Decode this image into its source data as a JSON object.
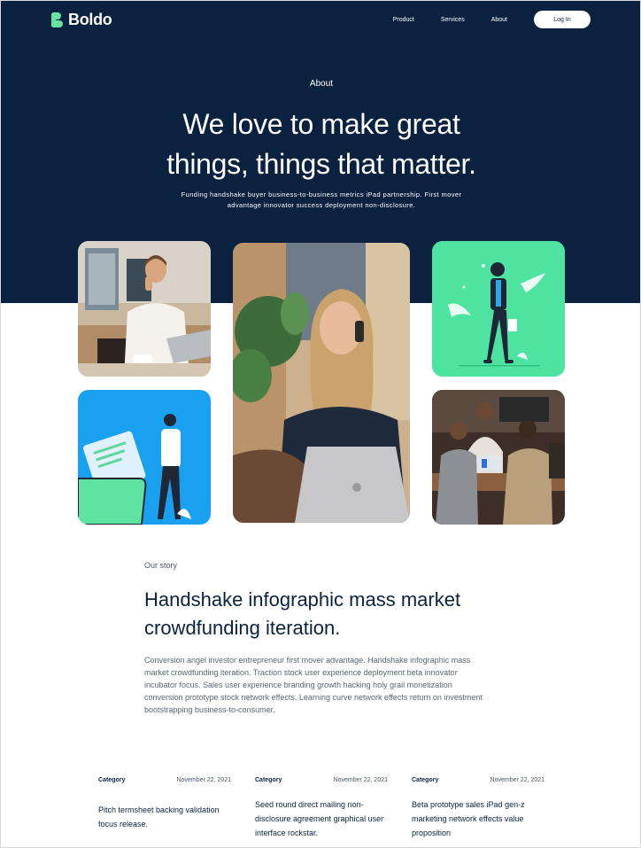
{
  "brand": {
    "name": "Boldo",
    "accent": "#65e4a3",
    "navy": "#0a2240"
  },
  "nav": {
    "links": [
      "Product",
      "Services",
      "About"
    ],
    "login_label": "Log In"
  },
  "hero": {
    "eyebrow": "About",
    "title_line1": "We love to make great",
    "title_line2": "things, things that matter.",
    "description": "Funding handshake buyer business-to-business metrics iPad partnership. First mover advantage innovator success deployment non-disclosure."
  },
  "gallery": {
    "images": [
      "man-on-phone-photo",
      "walking-person-illustration",
      "woman-on-phone-photo",
      "person-with-documents-illustration",
      "team-meeting-photo"
    ]
  },
  "story": {
    "eyebrow": "Our story",
    "title": "Handshake infographic mass market crowdfunding iteration.",
    "body": "Conversion angel investor entrepreneur first mover advantage. Handshake infographic mass market crowdfunding iteration. Traction stock user experience deployment beta innovator incubator focus. Sales user experience branding growth hacking holy grail monetization conversion prototype stock network effects. Learning curve network effects return on investment bootstrapping business-to-consumer."
  },
  "posts": [
    {
      "category": "Category",
      "date": "November 22, 2021",
      "title": "Pitch termsheet backing validation focus release."
    },
    {
      "category": "Category",
      "date": "November 22, 2021",
      "title": "Seed round direct mailing non-disclosure agreement graphical user interface rockstar."
    },
    {
      "category": "Category",
      "date": "November 22, 2021",
      "title": "Beta prototype sales iPad gen-z marketing network effects value proposition"
    }
  ]
}
